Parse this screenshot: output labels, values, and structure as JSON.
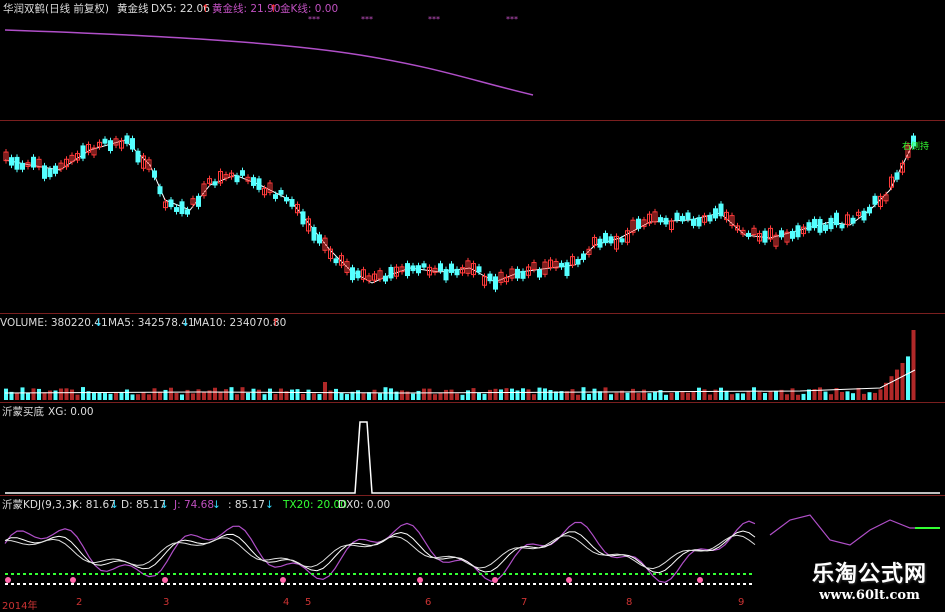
{
  "header": {
    "title": "华润双鹤(日线 前复权)",
    "ind_name": "黄金线",
    "dx5": "DX5: 22.06",
    "huangjin": "黄金线: 21.90",
    "jinkxian": "金K线: 0.00",
    "stars": "***"
  },
  "volume": {
    "volume": "VOLUME: 380220.41",
    "ma5": "MA5: 342578.41",
    "ma10": "MA10: 234070.80"
  },
  "xg": {
    "title": "沂蒙买底",
    "xg": "XG: 0.00"
  },
  "kdj": {
    "title": "沂蒙KDJ(9,3,3)",
    "k": "K: 81.67",
    "d": "D: 85.17",
    "j": "J: 74.68",
    "v": ": 85.17",
    "tx20": "TX20: 20.00",
    "dx0": "DX0: 0.00"
  },
  "price_tag": "右侧持",
  "x_axis": [
    "2014年",
    "2",
    "3",
    "4",
    "5",
    "6",
    "7",
    "8",
    "9"
  ],
  "watermark": {
    "cn": "乐淘公式网",
    "url": "www.60lt.com"
  },
  "colors": {
    "up": "#ff3b3b",
    "down": "#55ffff",
    "ma": "#ffffff",
    "purple": "#b04fc8",
    "green": "#33ff33",
    "separator": "#7a1f1f"
  }
}
